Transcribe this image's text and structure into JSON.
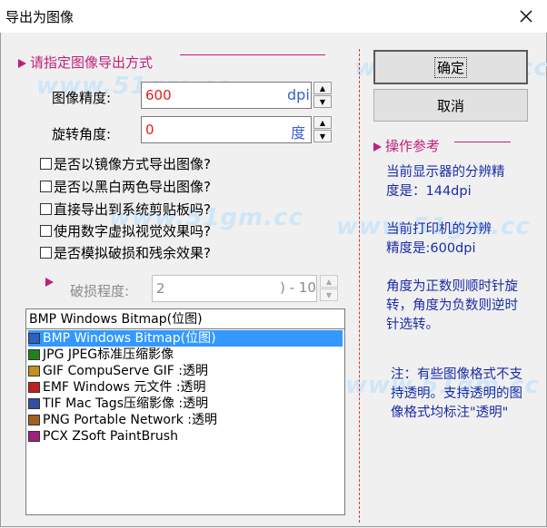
{
  "window": {
    "title": "导出为图像"
  },
  "left": {
    "section_title": "请指定图像导出方式",
    "precision_label": "图像精度:",
    "precision_value": "600",
    "precision_unit": "dpi",
    "rotation_label": "旋转角度:",
    "rotation_value": "0",
    "rotation_unit": "度",
    "checkboxes": [
      {
        "label": "是否以镜像方式导出图像?"
      },
      {
        "label": "是否以黑白两色导出图像?"
      },
      {
        "label": "直接导出到系统剪贴板吗?"
      },
      {
        "label": "使用数字虚拟视觉效果吗?"
      },
      {
        "label": "是否模拟破损和残余效果?"
      }
    ],
    "damage_label": "破损程度:",
    "damage_value": "2",
    "damage_range": ") - 10",
    "format_selected": "BMP Windows Bitmap(位图)",
    "formats": [
      {
        "label": "BMP Windows Bitmap(位图)",
        "icon": "bmp-icon",
        "color": "#3060c0"
      },
      {
        "label": "JPG JPEG标准压缩影像",
        "icon": "jpg-icon",
        "color": "#208020"
      },
      {
        "label": "GIF CompuServe GIF :透明",
        "icon": "gif-icon",
        "color": "#c09020"
      },
      {
        "label": "EMF Windows 元文件 :透明",
        "icon": "emf-icon",
        "color": "#c02020"
      },
      {
        "label": "TIF Mac Tags压缩影像 :透明",
        "icon": "tif-icon",
        "color": "#3050a0"
      },
      {
        "label": "PNG Portable Network :透明",
        "icon": "png-icon",
        "color": "#a06020"
      },
      {
        "label": "PCX ZSoft PaintBrush",
        "icon": "pcx-icon",
        "color": "#a02080"
      }
    ]
  },
  "right": {
    "ok_label": "确定",
    "cancel_label": "取消",
    "section_title": "操作参考",
    "info": [
      "当前显示器的分辨精度是：144dpi",
      "当前打印机的分辨精度是:600dpi",
      "角度为正数则顺时针旋转，角度为负数则逆时针选转。",
      "注：有些图像格式不支持透明。支持透明的图像格式均标注\"透明\""
    ]
  },
  "watermark": "www.51gm.cc",
  "colors": {
    "accent": "#c0207a",
    "info": "#1a2ca8",
    "selection": "#3399ff"
  }
}
